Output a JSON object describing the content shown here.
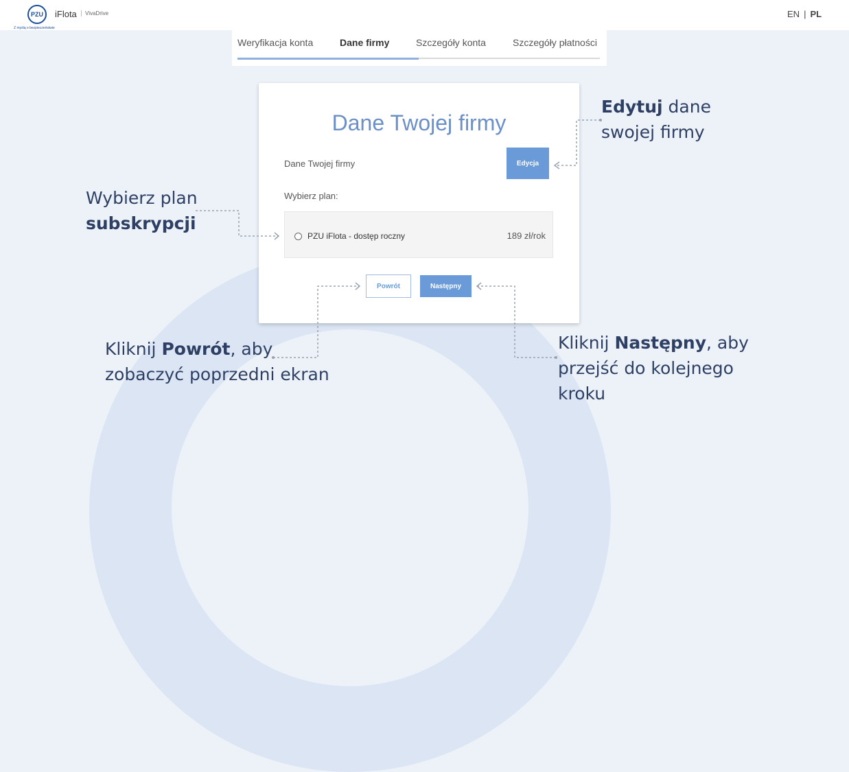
{
  "header": {
    "logo_text": "PZU",
    "brand": "iFlota",
    "brand_sub": "VivaDrive",
    "tagline": "Z myślą o bezpieczeństwie",
    "lang_en": "EN",
    "lang_sep": "|",
    "lang_pl": "PL"
  },
  "steps": {
    "items": [
      {
        "label": "Weryfikacja konta"
      },
      {
        "label": "Dane firmy"
      },
      {
        "label": "Szczegóły konta"
      },
      {
        "label": "Szczegóły płatności"
      }
    ],
    "active_index": 1,
    "progress": 0.5
  },
  "card": {
    "title": "Dane Twojej firmy",
    "company_label": "Dane Twojej firmy",
    "edit_label": "Edycja",
    "plan_label": "Wybierz plan:",
    "plan_name": "PZU iFlota - dostęp roczny",
    "plan_price": "189 zł/rok",
    "back_label": "Powrót",
    "next_label": "Następny"
  },
  "annotations": {
    "edit": {
      "bold": "Edytuj",
      "line1_rest": " dane",
      "line2": "swojej firmy"
    },
    "plan": {
      "line1": "Wybierz plan",
      "bold": "subskrypcji"
    },
    "back": {
      "pre": "Kliknij ",
      "bold": "Powrót",
      "post": ", aby",
      "line2": "zobaczyć poprzedni ekran"
    },
    "next": {
      "pre": "Kliknij ",
      "bold": "Następny",
      "post": ", aby",
      "line2": "przejść do kolejnego",
      "line3": "kroku"
    }
  },
  "colors": {
    "accent": "#6a9ad8",
    "annotation": "#2d3f63",
    "title": "#6b8fc7"
  }
}
